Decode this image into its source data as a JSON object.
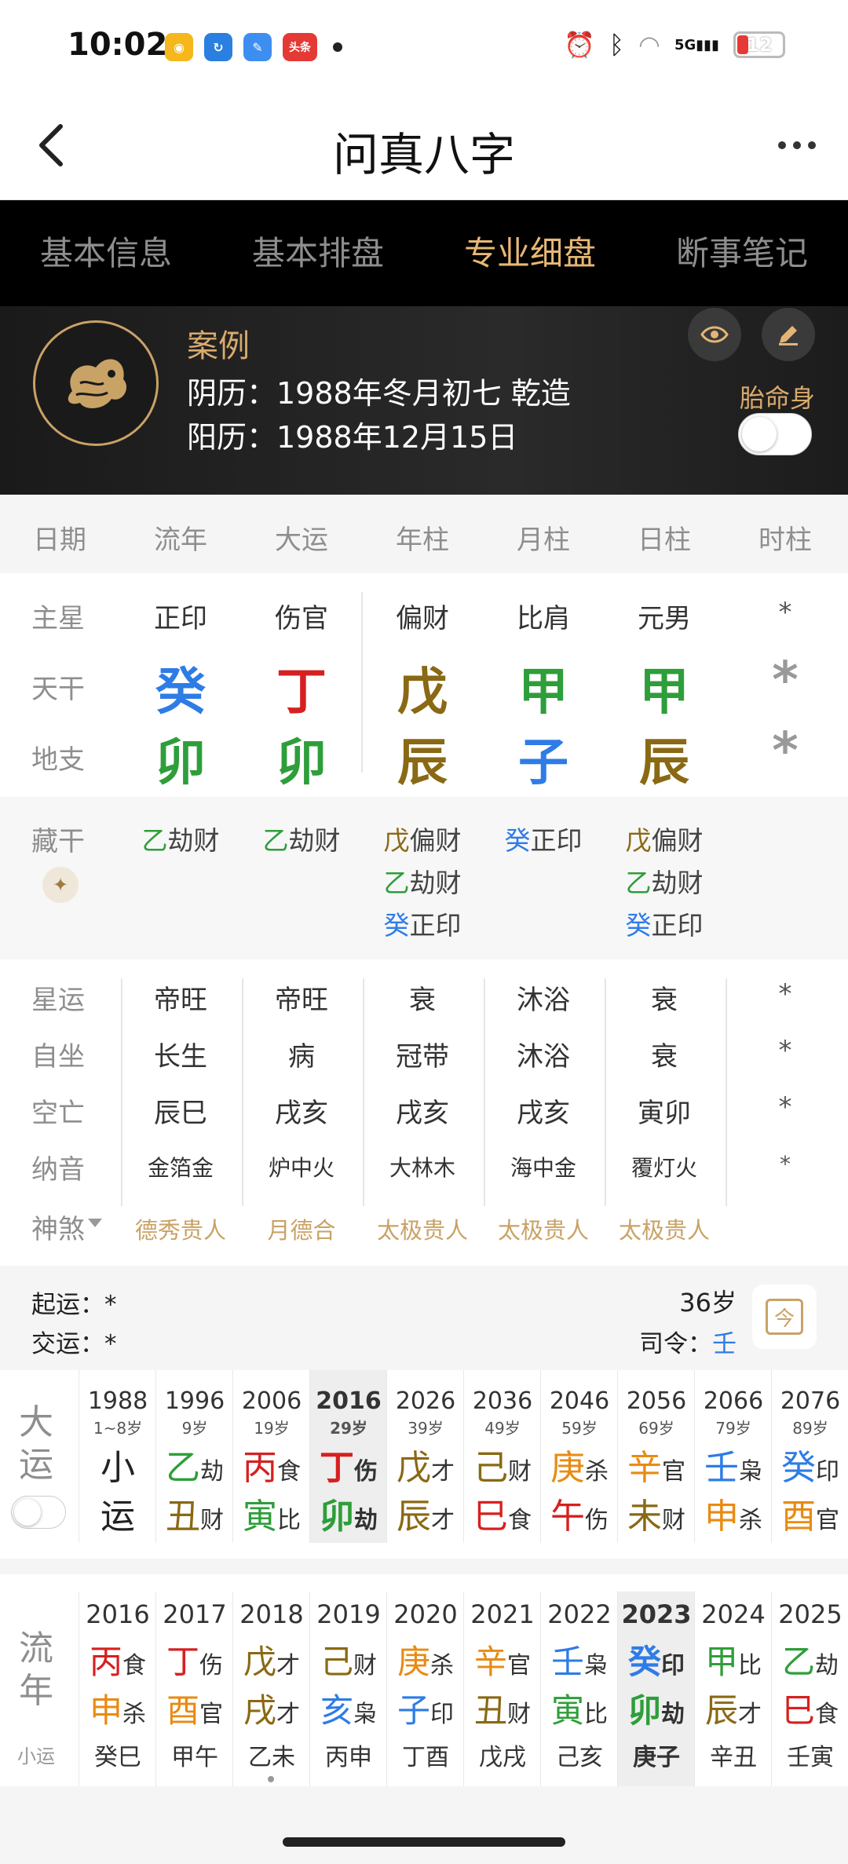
{
  "status_bar": {
    "time": "10:02",
    "apps": [
      "weibo",
      "app-blue",
      "app-feather",
      "头条"
    ],
    "battery": "12",
    "network": "5G"
  },
  "nav": {
    "title": "问真八字",
    "back_icon": "chevron-left-icon",
    "more_icon": "more-dots-icon"
  },
  "tabs": [
    {
      "label": "基本信息",
      "active": false
    },
    {
      "label": "基本排盘",
      "active": false
    },
    {
      "label": "专业细盘",
      "active": true
    },
    {
      "label": "断事笔记",
      "active": false
    }
  ],
  "profile": {
    "name": "案例",
    "lunar": "阴历：1988年冬月初七 乾造",
    "solar": "阳历：1988年12月15日",
    "toggle_label": "胎命身",
    "toggle_on": false
  },
  "columns": [
    "日期",
    "流年",
    "大运",
    "年柱",
    "月柱",
    "日柱",
    "时柱"
  ],
  "rows": {
    "zhuxing": {
      "label": "主星",
      "values": [
        "正印",
        "伤官",
        "偏财",
        "比肩",
        "元男",
        "*"
      ]
    },
    "tiangan": {
      "label": "天干",
      "values": [
        "癸",
        "丁",
        "戊",
        "甲",
        "甲",
        "*"
      ]
    },
    "dizhi": {
      "label": "地支",
      "values": [
        "卯",
        "卯",
        "辰",
        "子",
        "辰",
        "*"
      ]
    }
  },
  "canggan": {
    "label": "藏干",
    "cols": [
      [
        {
          "g": "乙",
          "s": "劫财"
        }
      ],
      [
        {
          "g": "乙",
          "s": "劫财"
        }
      ],
      [
        {
          "g": "戊",
          "s": "偏财"
        },
        {
          "g": "乙",
          "s": "劫财"
        },
        {
          "g": "癸",
          "s": "正印"
        }
      ],
      [
        {
          "g": "癸",
          "s": "正印"
        }
      ],
      [
        {
          "g": "戊",
          "s": "偏财"
        },
        {
          "g": "乙",
          "s": "劫财"
        },
        {
          "g": "癸",
          "s": "正印"
        }
      ]
    ]
  },
  "details": {
    "xingyun": {
      "label": "星运",
      "values": [
        "帝旺",
        "帝旺",
        "衰",
        "沐浴",
        "衰",
        "*"
      ]
    },
    "zizuo": {
      "label": "自坐",
      "values": [
        "长生",
        "病",
        "冠带",
        "沐浴",
        "衰",
        "*"
      ]
    },
    "kongwang": {
      "label": "空亡",
      "values": [
        "辰巳",
        "戌亥",
        "戌亥",
        "戌亥",
        "寅卯",
        "*"
      ]
    },
    "nayin": {
      "label": "纳音",
      "values": [
        "金箔金",
        "炉中火",
        "大林木",
        "海中金",
        "覆灯火",
        "*"
      ]
    }
  },
  "shensha": {
    "label": "神煞",
    "values": [
      "德秀贵人",
      "月德合",
      "太极贵人",
      "太极贵人",
      "太极贵人"
    ]
  },
  "qiyun": {
    "start_label": "起运：",
    "start_value": "*",
    "jiao_label": "交运：",
    "jiao_value": "*",
    "age": "36岁",
    "siling_label": "司令：",
    "siling_value": "壬",
    "calendar_char": "今"
  },
  "dayun": {
    "label_1": "大",
    "label_2": "运",
    "cols": [
      {
        "year": "1988",
        "age": "1~8岁",
        "top": "小",
        "top_ss": "",
        "bot": "运",
        "bot_ss": ""
      },
      {
        "year": "1996",
        "age": "9岁",
        "top": "乙",
        "top_ss": "劫",
        "bot": "丑",
        "bot_ss": "财"
      },
      {
        "year": "2006",
        "age": "19岁",
        "top": "丙",
        "top_ss": "食",
        "bot": "寅",
        "bot_ss": "比"
      },
      {
        "year": "2016",
        "age": "29岁",
        "top": "丁",
        "top_ss": "伤",
        "bot": "卯",
        "bot_ss": "劫",
        "active": true
      },
      {
        "year": "2026",
        "age": "39岁",
        "top": "戊",
        "top_ss": "才",
        "bot": "辰",
        "bot_ss": "才"
      },
      {
        "year": "2036",
        "age": "49岁",
        "top": "己",
        "top_ss": "财",
        "bot": "巳",
        "bot_ss": "食"
      },
      {
        "year": "2046",
        "age": "59岁",
        "top": "庚",
        "top_ss": "杀",
        "bot": "午",
        "bot_ss": "伤"
      },
      {
        "year": "2056",
        "age": "69岁",
        "top": "辛",
        "top_ss": "官",
        "bot": "未",
        "bot_ss": "财"
      },
      {
        "year": "2066",
        "age": "79岁",
        "top": "壬",
        "top_ss": "枭",
        "bot": "申",
        "bot_ss": "杀"
      },
      {
        "year": "2076",
        "age": "89岁",
        "top": "癸",
        "top_ss": "印",
        "bot": "酉",
        "bot_ss": "官"
      }
    ]
  },
  "liunian": {
    "label_1": "流",
    "label_2": "年",
    "sub": "小运",
    "cols": [
      {
        "year": "2016",
        "top": "丙",
        "top_ss": "食",
        "bot": "申",
        "bot_ss": "杀",
        "xy": "癸巳"
      },
      {
        "year": "2017",
        "top": "丁",
        "top_ss": "伤",
        "bot": "酉",
        "bot_ss": "官",
        "xy": "甲午"
      },
      {
        "year": "2018",
        "top": "戊",
        "top_ss": "才",
        "bot": "戌",
        "bot_ss": "才",
        "xy": "乙未"
      },
      {
        "year": "2019",
        "top": "己",
        "top_ss": "财",
        "bot": "亥",
        "bot_ss": "枭",
        "xy": "丙申"
      },
      {
        "year": "2020",
        "top": "庚",
        "top_ss": "杀",
        "bot": "子",
        "bot_ss": "印",
        "xy": "丁酉"
      },
      {
        "year": "2021",
        "top": "辛",
        "top_ss": "官",
        "bot": "丑",
        "bot_ss": "财",
        "xy": "戊戌"
      },
      {
        "year": "2022",
        "top": "壬",
        "top_ss": "枭",
        "bot": "寅",
        "bot_ss": "比",
        "xy": "己亥"
      },
      {
        "year": "2023",
        "top": "癸",
        "top_ss": "印",
        "bot": "卯",
        "bot_ss": "劫",
        "xy": "庚子",
        "active": true
      },
      {
        "year": "2024",
        "top": "甲",
        "top_ss": "比",
        "bot": "辰",
        "bot_ss": "才",
        "xy": "辛丑"
      },
      {
        "year": "2025",
        "top": "乙",
        "top_ss": "劫",
        "bot": "巳",
        "bot_ss": "食",
        "xy": "壬寅"
      }
    ]
  },
  "colors": {
    "癸": "#2e7ce6",
    "壬": "#2e7ce6",
    "子": "#2e7ce6",
    "亥": "#2e7ce6",
    "甲": "#2e9e3a",
    "乙": "#2e9e3a",
    "寅": "#2e9e3a",
    "卯": "#2e9e3a",
    "丙": "#d62020",
    "丁": "#d62020",
    "巳": "#d62020",
    "午": "#d62020",
    "戊": "#8a6914",
    "己": "#8a6914",
    "辰": "#8a6914",
    "丑": "#8a6914",
    "未": "#8a6914",
    "戌": "#8a6914",
    "庚": "#e88b13",
    "辛": "#e88b13",
    "申": "#e88b13",
    "酉": "#e88b13",
    "小": "#222222",
    "运": "#222222",
    "*": "#999999"
  }
}
